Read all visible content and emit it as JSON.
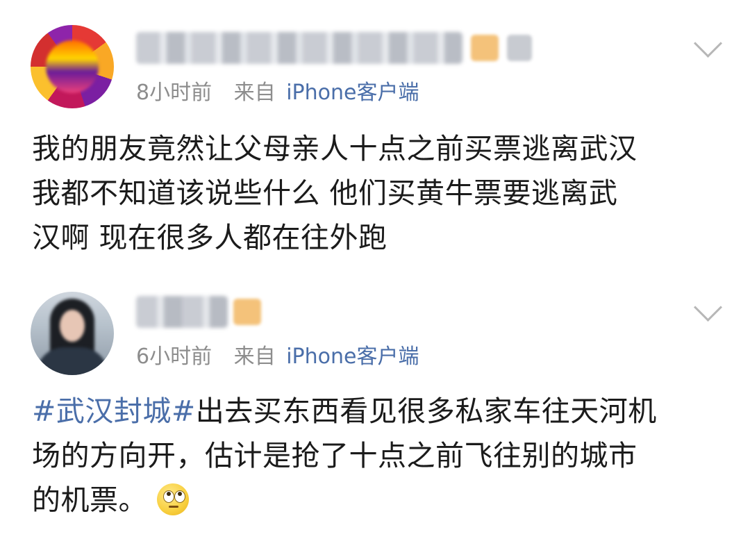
{
  "posts": [
    {
      "time": "8小时前",
      "source_prefix": "来自",
      "source_name": "iPhone客户端",
      "content_lines": [
        "我的朋友竟然让父母亲人十点之前买票逃离武汉",
        "我都不知道该说些什么  他们买黄牛票要逃离武",
        "汉啊 现在很多人都在往外跑"
      ]
    },
    {
      "time": "6小时前",
      "source_prefix": "来自",
      "source_name": "iPhone客户端",
      "hashtag": "#武汉封城#",
      "content_lines": [
        "出去买东西看见很多私家车往天河机",
        "场的方向开，估计是抢了十点之前飞往别的城市",
        "的机票。"
      ],
      "emoji": "rolling-eyes-emoji"
    }
  ],
  "icons": {
    "menu": "chevron-down-icon"
  },
  "colors": {
    "link": "#4a6ea9",
    "meta": "#8d8d8d",
    "text": "#1b1b1b"
  }
}
